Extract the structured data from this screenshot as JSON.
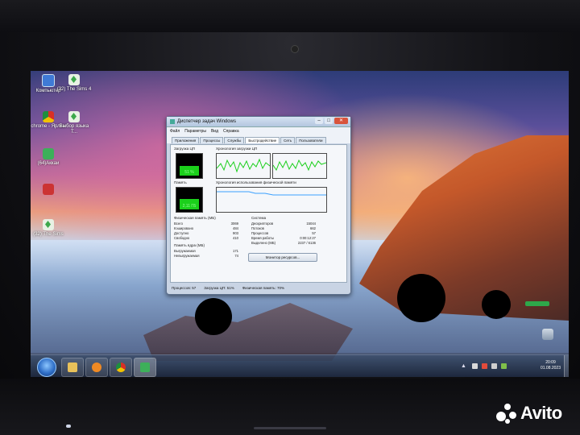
{
  "desktop": {
    "icons": [
      {
        "label": "Компьютер",
        "icon": "computer-icon"
      },
      {
        "label": "(32) The Sims 4",
        "icon": "sims-icon"
      },
      {
        "label": "chrome - Ярлык",
        "icon": "chrome-icon"
      },
      {
        "label": "Выбор языка T...",
        "icon": "sims-icon"
      },
      {
        "label": "(64)Аккаи",
        "icon": "app-icon"
      },
      {
        "label": "",
        "icon": "red-app-icon"
      },
      {
        "label": "(32) The Sims",
        "icon": "sims-icon"
      },
      {
        "label": "",
        "icon": "recycle-bin-icon"
      }
    ]
  },
  "task_manager": {
    "title": "Диспетчер задач Windows",
    "window_buttons": {
      "minimize": "–",
      "maximize": "□",
      "close": "✕"
    },
    "menu": [
      "Файл",
      "Параметры",
      "Вид",
      "Справка"
    ],
    "tabs": [
      "Приложения",
      "Процессы",
      "Службы",
      "Быстродействие",
      "Сеть",
      "Пользователи"
    ],
    "active_tab": "Быстродействие",
    "cpu_usage_label": "Загрузка ЦП",
    "cpu_history_label": "Хронология загрузки ЦП",
    "cpu_percent": "51 %",
    "cpu_fill": 0.51,
    "memory_label": "Память",
    "memory_value": "2,11 ГБ",
    "memory_fill": 0.55,
    "memory_history_label": "Хронология использования физической памяти",
    "physical_memory": {
      "header": "Физическая память (МБ)",
      "rows": [
        {
          "label": "Всего",
          "value": "3069"
        },
        {
          "label": "Кэшировано",
          "value": "484"
        },
        {
          "label": "Доступно",
          "value": "903"
        },
        {
          "label": "Свободно",
          "value": "410"
        }
      ]
    },
    "kernel_memory": {
      "header": "Память ядра (МБ)",
      "rows": [
        {
          "label": "Выгружаемая",
          "value": "171"
        },
        {
          "label": "Невыгружаемая",
          "value": "74"
        }
      ]
    },
    "system": {
      "header": "Система",
      "rows": [
        {
          "label": "Дескрипторов",
          "value": "15044"
        },
        {
          "label": "Потоков",
          "value": "662"
        },
        {
          "label": "Процессов",
          "value": "57"
        },
        {
          "label": "Время работы",
          "value": "0:00:12:27"
        },
        {
          "label": "Выделено (МБ)",
          "value": "2237 / 6136"
        }
      ]
    },
    "resource_monitor_button": "Монитор ресурсов...",
    "status": {
      "processes": "Процессов: 57",
      "cpu": "Загрузка ЦП: 51%",
      "memory": "Физическая память: 70%"
    }
  },
  "taskbar": {
    "clock_time": "20:09",
    "clock_date": "01.08.2023",
    "tray_arrow": "▲"
  },
  "watermark": {
    "brand": "Avito"
  },
  "colors": {
    "graph_green": "#1bd01b",
    "titlebar": "#b3c6df",
    "close_red": "#d8543c"
  }
}
